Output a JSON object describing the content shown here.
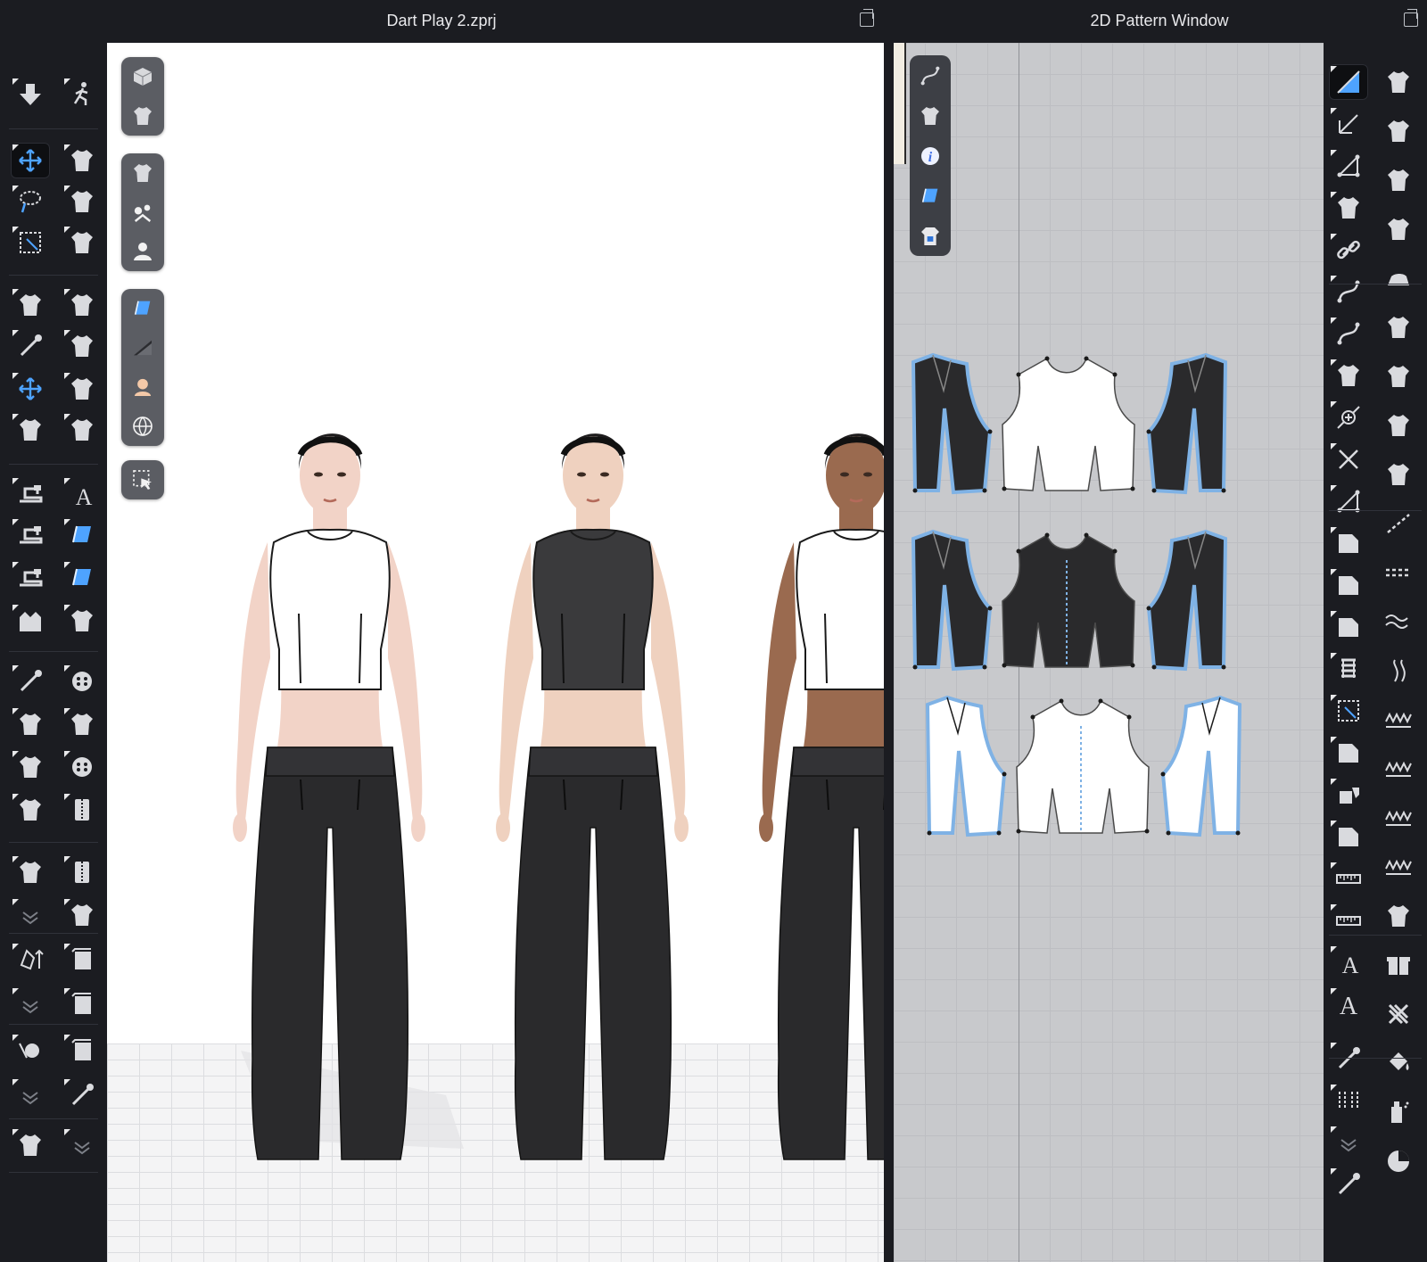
{
  "left_window": {
    "title": "Dart Play 2.zprj"
  },
  "right_window": {
    "title": "2D Pattern Window"
  },
  "colors": {
    "chrome_bg": "#1b1c21",
    "viewport_bg": "#ffffff",
    "pattern_bg": "#c8c9cc",
    "pattern_edge_blue": "#7fb2e5",
    "garment_dark": "#2a2a2c",
    "garment_white": "#ffffff"
  },
  "left_tools": [
    "simulation-down-icon",
    "avatar-walk-icon",
    "transform-move-icon",
    "fold-garment-icon",
    "lasso-select-icon",
    "fold-arrange-icon",
    "box-select-icon",
    "tack-icon",
    "garment-select-icon",
    "garment-transform-icon",
    "garment-pin-icon",
    "garment-twist-icon",
    "garment-move-icon",
    "garment-fold-icon",
    "garment-fit-icon",
    "garment-hand-icon",
    "sewing-machine-icon",
    "texture-pattern-icon",
    "sewing-grid-icon",
    "fabric-check-icon",
    "sewing-wave-icon",
    "fabric-grid-icon",
    "avatar-measure-icon",
    "button-add-icon",
    "pin-needle-icon",
    "button-icon",
    "trim-knob-icon",
    "buttonhole-icon",
    "shirt-edit-icon",
    "lock-button-icon",
    "arrange-icon",
    "zipper-icon",
    "fold-shirt-icon",
    "zipper-pull-icon",
    "collapse-chevron-icon",
    "puckering-icon",
    "avatar-size-icon",
    "cylinder-icon",
    "collapse-chevron-icon",
    "shade-icon",
    "tape-measure-icon",
    "shade-box-icon",
    "collapse-chevron-icon",
    "pin-collapse-icon",
    "shirt-sewing-icon",
    "collapse-chevron-icon"
  ],
  "viewport_toolbar": [
    [
      "cube-view-icon",
      "tshirt-settings-icon"
    ],
    [
      "tshirt-icon",
      "avatar-parts-icon",
      "avatar-icon"
    ],
    [
      "fabric-icon",
      "shading-icon",
      "skin-icon",
      "globe-icon"
    ],
    [
      "select-cursor-icon"
    ]
  ],
  "pattern_toolbar": [
    "pen-curve-icon",
    "tshirt-icon",
    "info-icon",
    "fabric-icon",
    "tshirt-lock-icon"
  ],
  "right_tools_a": [
    "edit-pattern-icon",
    "transform-points-icon",
    "polygon-icon",
    "add-point-icon",
    "link-icon",
    "curve-point-icon",
    "curve-icon",
    "split-icon",
    "add-point-plus-icon",
    "cross-line-icon",
    "measure-angle-icon",
    "rectangle-pattern-icon",
    "panel-icon",
    "trace-icon",
    "spring-icon",
    "select-box-icon",
    "internal-shape-icon",
    "dart-icon",
    "seam-panel-icon",
    "ruler-icon",
    "grain-ruler-icon",
    "text-icon",
    "text-large-icon",
    "annotation-icon",
    "layout-icon",
    "collapse-chevron-icon",
    "segment-edit-icon"
  ],
  "right_tools_b": [
    "edit-sewing-icon",
    "segment-sew-icon",
    "freeform-sew-icon",
    "sew-check-icon",
    "iron-icon",
    "tshirt-edit-icon",
    "tshirt-fold-icon",
    "tshirt-grid-icon",
    "tshirt-check-icon",
    "dashed-line-icon",
    "double-dash-icon",
    "wave-line-icon",
    "pleat-icon",
    "elastic-icon",
    "zigzag-icon",
    "zigzag-double-icon",
    "ruffle-icon",
    "add-pocket-icon",
    "gift-box-icon",
    "cross-x-icon",
    "paint-bucket-icon",
    "paint-spray-icon",
    "color-circle-icon"
  ],
  "models": [
    {
      "top_color": "#ffffff",
      "skin": "#f2d3c7",
      "pants": "#2a2a2c"
    },
    {
      "top_color": "#3a3a3c",
      "skin": "#efd1bf",
      "pants": "#2a2a2c"
    },
    {
      "top_color": "#ffffff",
      "skin": "#9a6a4f",
      "pants": "#2a2a2c"
    }
  ],
  "pattern_rows": [
    {
      "fill": "#2a2a2c",
      "center_fill": "#ffffff"
    },
    {
      "fill": "#2a2a2c",
      "center_fill": "#2a2a2c"
    },
    {
      "fill": "#ffffff",
      "center_fill": "#ffffff"
    }
  ]
}
